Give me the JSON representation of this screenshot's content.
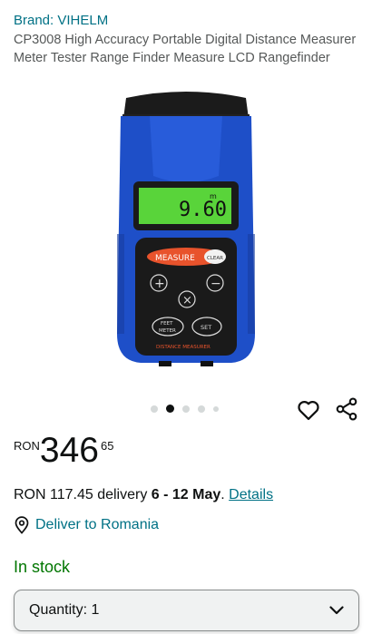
{
  "brand": "Brand: VIHELM",
  "title": "CP3008 High Accuracy Portable Digital Distance Measurer Meter Tester Range Finder Measure LCD Rangefinder",
  "product_image": {
    "display_reading": "9.60",
    "display_unit": "m",
    "measure_label": "MEASURE",
    "clear_label": "CLEAR",
    "plus_label": "+",
    "minus_label": "−",
    "x_label": "×",
    "feet_label": "FEET",
    "meter_label": "METER",
    "set_label": "SET",
    "footer_label": "DISTANCE MEASURER"
  },
  "carousel": {
    "total": 5,
    "active_index": 1
  },
  "price": {
    "currency": "RON",
    "whole": "346",
    "fraction": "65"
  },
  "delivery": {
    "prefix": "RON 117.45 delivery ",
    "dates": "6 - 12 May",
    "separator": ". ",
    "details_link": "Details"
  },
  "deliver_to": "Deliver to Romania",
  "stock": "In stock",
  "quantity": {
    "label": "Quantity:",
    "value": "1"
  },
  "colors": {
    "link": "#007185",
    "stock": "#007600",
    "device_blue": "#1e4fc8"
  }
}
